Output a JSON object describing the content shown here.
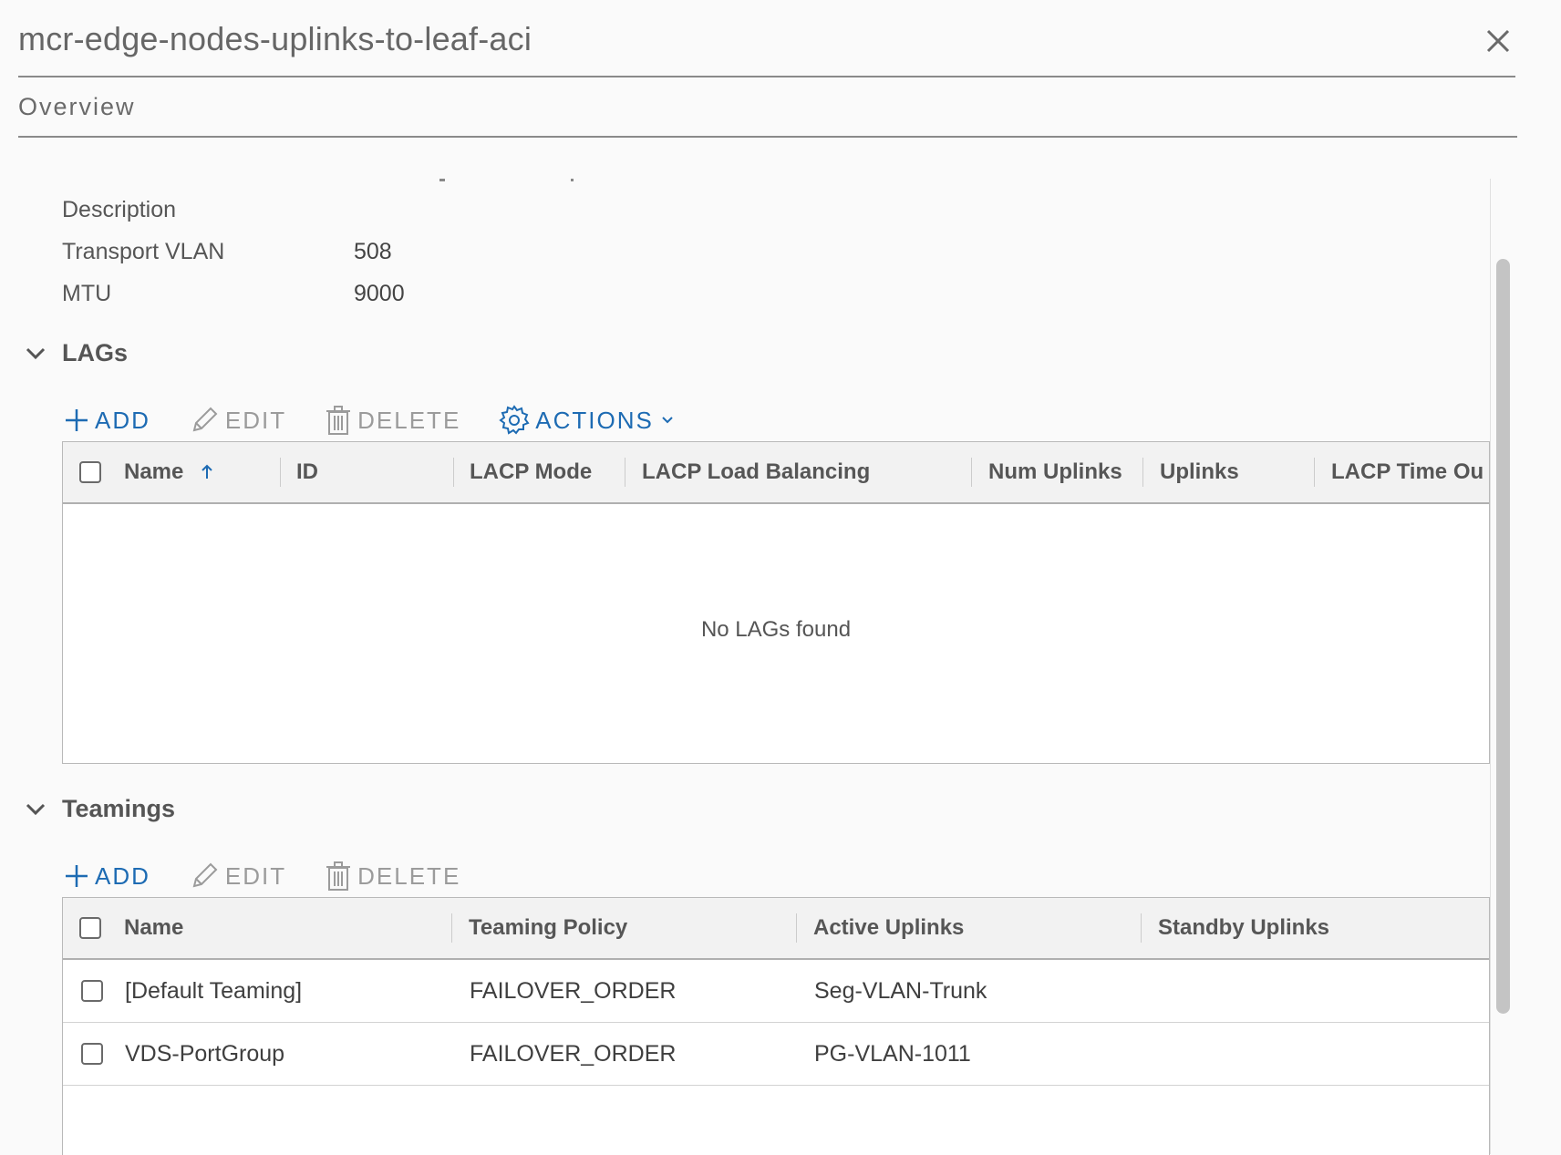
{
  "header": {
    "title": "mcr-edge-nodes-uplinks-to-leaf-aci",
    "tab": "Overview"
  },
  "properties": {
    "description_label": "Description",
    "transport_vlan_label": "Transport VLAN",
    "transport_vlan_value": "508",
    "mtu_label": "MTU",
    "mtu_value": "9000"
  },
  "lags": {
    "title": "LAGs",
    "toolbar": {
      "add": "ADD",
      "edit": "EDIT",
      "delete": "DELETE",
      "actions": "ACTIONS"
    },
    "columns": [
      "Name",
      "ID",
      "LACP Mode",
      "LACP Load Balancing",
      "Num Uplinks",
      "Uplinks",
      "LACP Time Ou"
    ],
    "empty_text": "No LAGs found"
  },
  "teamings": {
    "title": "Teamings",
    "toolbar": {
      "add": "ADD",
      "edit": "EDIT",
      "delete": "DELETE"
    },
    "columns": [
      "Name",
      "Teaming Policy",
      "Active Uplinks",
      "Standby Uplinks"
    ],
    "rows": [
      {
        "name": "[Default Teaming]",
        "policy": "FAILOVER_ORDER",
        "active": "Seg-VLAN-Trunk",
        "standby": ""
      },
      {
        "name": "VDS-PortGroup",
        "policy": "FAILOVER_ORDER",
        "active": "PG-VLAN-1011",
        "standby": ""
      }
    ]
  },
  "icons": {
    "close": "close-icon",
    "chevron": "chevron-down-icon",
    "add": "plus-icon",
    "edit": "pencil-icon",
    "delete": "trash-icon",
    "actions": "gear-icon",
    "sort": "sort-ascending-icon"
  },
  "colors": {
    "accent": "#1d6bb3",
    "disabled": "#9b9b9b"
  }
}
